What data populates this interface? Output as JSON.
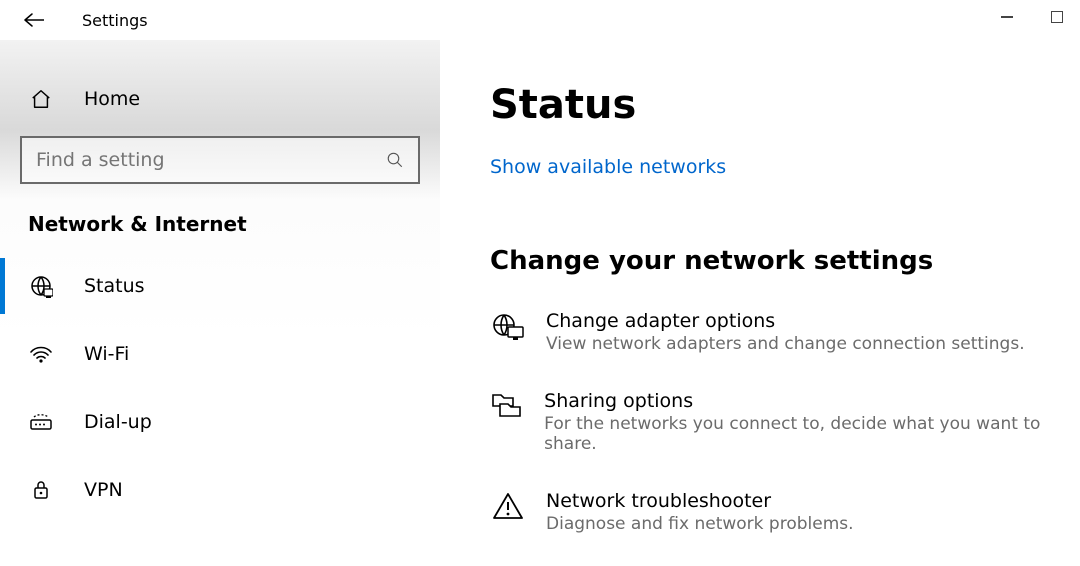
{
  "titlebar": {
    "title": "Settings"
  },
  "sidebar": {
    "home_label": "Home",
    "search_placeholder": "Find a setting",
    "section": "Network & Internet",
    "items": [
      {
        "label": "Status"
      },
      {
        "label": "Wi-Fi"
      },
      {
        "label": "Dial-up"
      },
      {
        "label": "VPN"
      }
    ]
  },
  "main": {
    "page_title": "Status",
    "link_show_networks": "Show available networks",
    "subheading": "Change your network settings",
    "items": [
      {
        "title": "Change adapter options",
        "desc": "View network adapters and change connection settings."
      },
      {
        "title": "Sharing options",
        "desc": "For the networks you connect to, decide what you want to share."
      },
      {
        "title": "Network troubleshooter",
        "desc": "Diagnose and fix network problems."
      }
    ]
  }
}
